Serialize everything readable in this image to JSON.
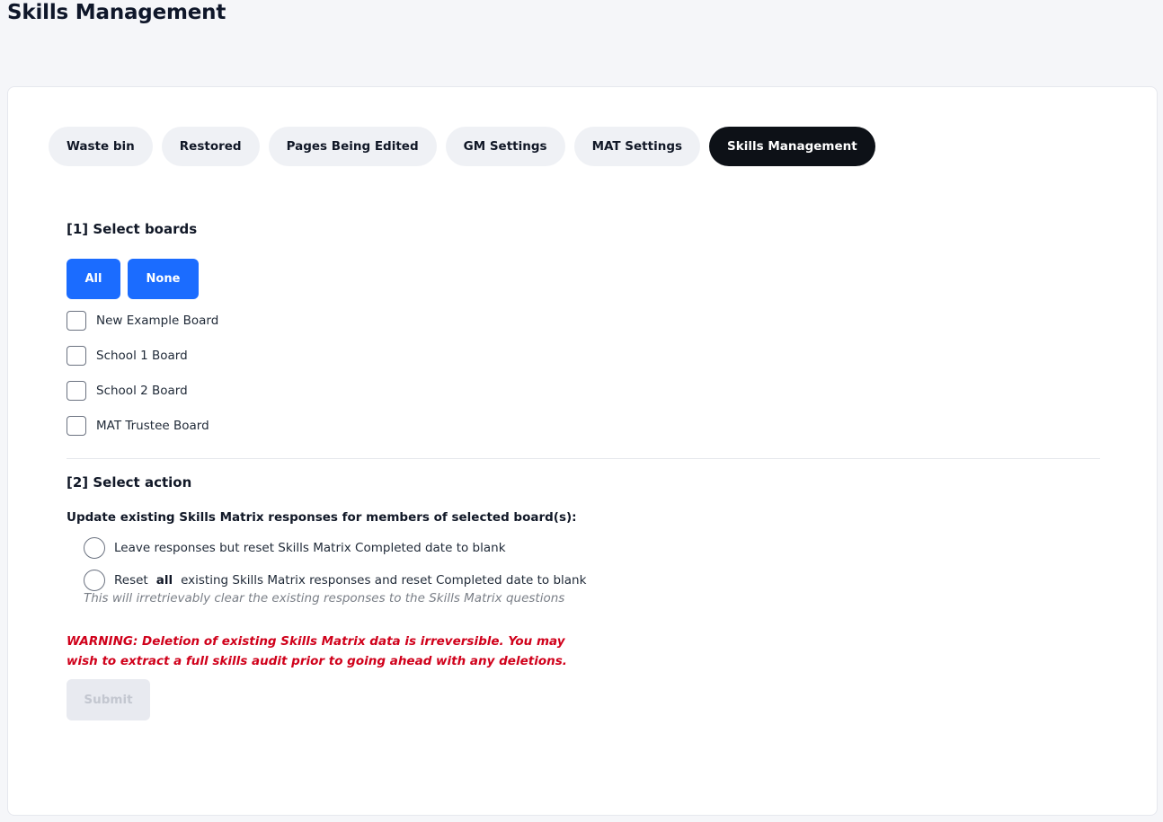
{
  "page": {
    "title": "Skills Management"
  },
  "tabs": [
    {
      "label": "Waste bin",
      "active": false
    },
    {
      "label": "Restored",
      "active": false
    },
    {
      "label": "Pages Being Edited",
      "active": false
    },
    {
      "label": "GM Settings",
      "active": false
    },
    {
      "label": "MAT Settings",
      "active": false
    },
    {
      "label": "Skills Management",
      "active": true
    }
  ],
  "section1": {
    "heading": "[1] Select boards",
    "all_label": "All",
    "none_label": "None",
    "boards": [
      {
        "label": "New Example Board",
        "checked": false
      },
      {
        "label": "School 1 Board",
        "checked": false
      },
      {
        "label": "School 2 Board",
        "checked": false
      },
      {
        "label": "MAT Trustee Board",
        "checked": false
      }
    ]
  },
  "section2": {
    "heading": "[2] Select action",
    "question": "Update existing Skills Matrix responses for members of selected board(s):",
    "option1_label": "Leave responses but reset Skills Matrix Completed date to blank",
    "option2_prefix": "Reset",
    "option2_bold": "all",
    "option2_suffix": "existing Skills Matrix responses and reset Completed date to blank",
    "option2_note": "This will irretrievably clear the existing responses to the Skills Matrix questions",
    "warning": "WARNING: Deletion of existing Skills Matrix data is irreversible. You may wish to extract a full skills audit prior to going ahead with any deletions.",
    "submit_label": "Submit",
    "submit_disabled": true
  },
  "colors": {
    "accent": "#1b6cff",
    "active_tab": "#0d1117",
    "warning": "#d0011b"
  }
}
